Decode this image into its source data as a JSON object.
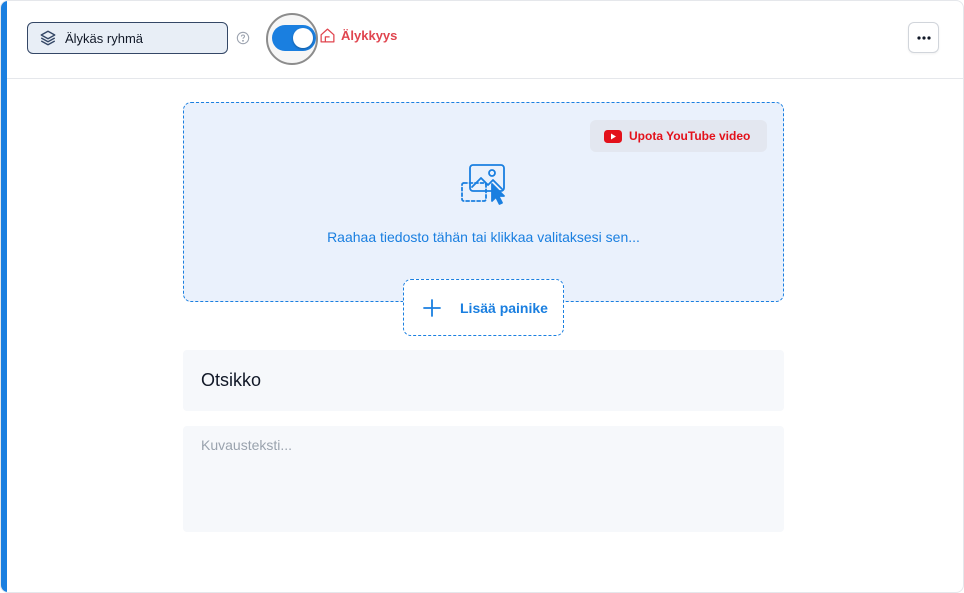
{
  "toolbar": {
    "group_label": "Älykäs ryhmä",
    "group_icon": "layers-icon",
    "help_icon": "help-circle-icon",
    "ai_toggle_on": true,
    "ai_label": "Älykkyys",
    "ai_icon": "home-ai-icon",
    "more_icon": "more-horizontal-icon"
  },
  "media": {
    "youtube_label": "Upota YouTube video",
    "youtube_icon": "youtube-icon",
    "upload_icon": "image-upload-icon",
    "drop_text": "Raahaa tiedosto tähän tai klikkaa valitaksesi sen...",
    "add_button_label": "Lisää painike",
    "add_icon": "plus-icon"
  },
  "form": {
    "title_value": "Otsikko",
    "description_placeholder": "Kuvausteksti..."
  },
  "colors": {
    "accent": "#1a7fe0",
    "ai_red": "#e0454f",
    "youtube_red": "#e3111b"
  }
}
